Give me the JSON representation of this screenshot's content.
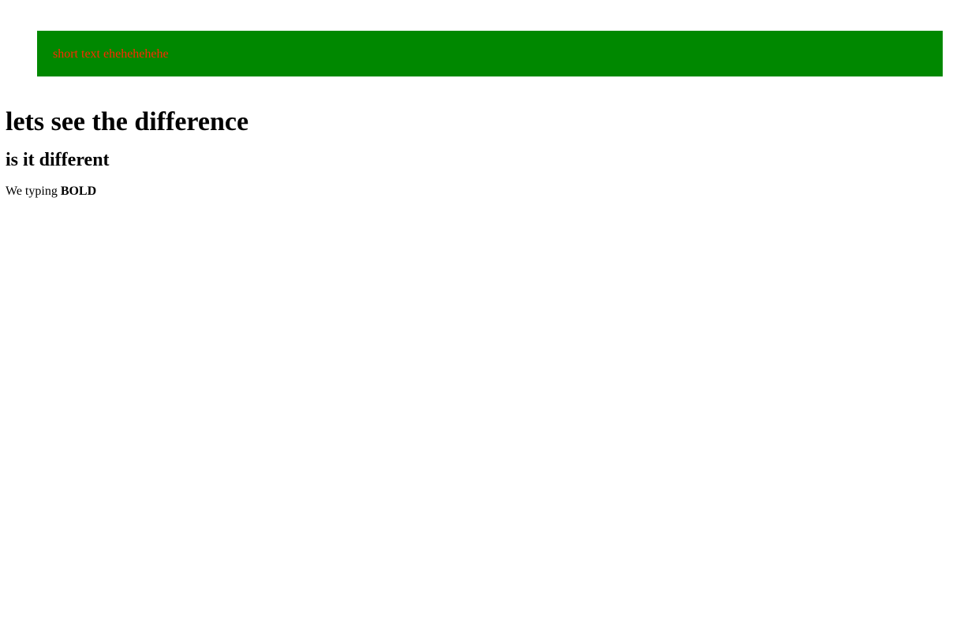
{
  "banner": {
    "text": "short text ehehehehehe",
    "background_color": "#008800",
    "text_color": "#ff2a00"
  },
  "main": {
    "heading": "lets see the difference",
    "subheading": "is it different",
    "paragraph_text": "We typing ",
    "paragraph_bold": "BOLD"
  }
}
